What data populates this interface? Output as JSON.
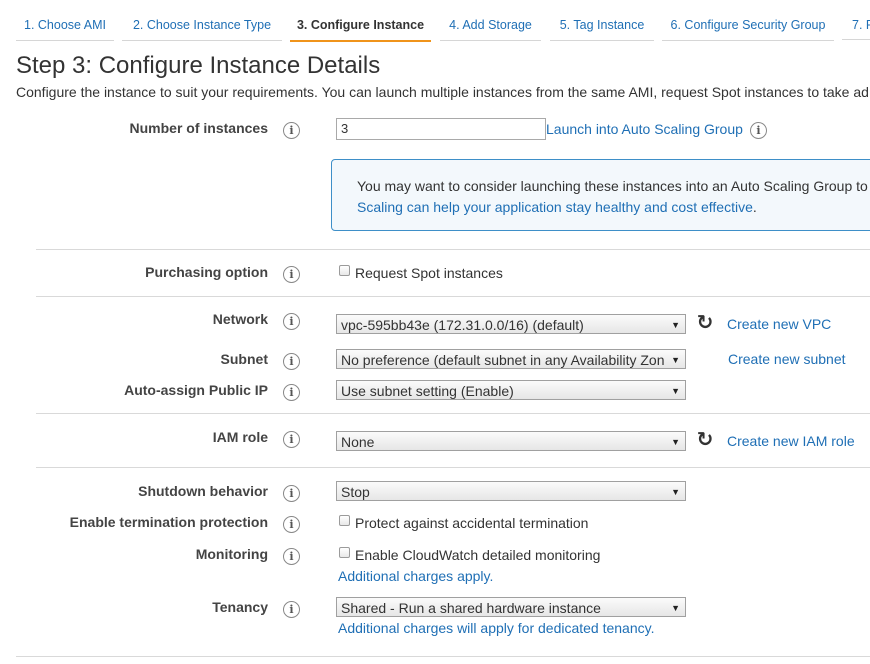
{
  "wizard": {
    "tabs": [
      {
        "label": "1. Choose AMI",
        "active": false
      },
      {
        "label": "2. Choose Instance Type",
        "active": false
      },
      {
        "label": "3. Configure Instance",
        "active": true
      },
      {
        "label": "4. Add Storage",
        "active": false
      },
      {
        "label": "5. Tag Instance",
        "active": false
      },
      {
        "label": "6. Configure Security Group",
        "active": false
      },
      {
        "label": "7. R",
        "active": false
      }
    ]
  },
  "page": {
    "title": "Step 3: Configure Instance Details",
    "description": "Configure the instance to suit your requirements. You can launch multiple instances from the same AMI, request Spot instances to take ad"
  },
  "form": {
    "instances": {
      "label": "Number of instances",
      "value": "3",
      "link": "Launch into Auto Scaling Group"
    },
    "notice": {
      "line1": "You may want to consider launching these instances into an Auto Scaling Group to",
      "line2_link": "Scaling can help your application stay healthy and cost effective",
      "line2_tail": "."
    },
    "purchasing": {
      "label": "Purchasing option",
      "checkbox_label": "Request Spot instances",
      "checked": false
    },
    "network": {
      "label": "Network",
      "value": "vpc-595bb43e (172.31.0.0/16) (default)",
      "link": "Create new VPC"
    },
    "subnet": {
      "label": "Subnet",
      "value": "No preference (default subnet in any Availability Zon",
      "link": "Create new subnet"
    },
    "public_ip": {
      "label": "Auto-assign Public IP",
      "value": "Use subnet setting (Enable)"
    },
    "iam_role": {
      "label": "IAM role",
      "value": "None",
      "link": "Create new IAM role"
    },
    "shutdown": {
      "label": "Shutdown behavior",
      "value": "Stop"
    },
    "termination": {
      "label": "Enable termination protection",
      "checkbox_label": "Protect against accidental termination",
      "checked": false
    },
    "monitoring": {
      "label": "Monitoring",
      "checkbox_label": "Enable CloudWatch detailed monitoring",
      "checked": false,
      "note_link": "Additional charges apply."
    },
    "tenancy": {
      "label": "Tenancy",
      "value": "Shared - Run a shared hardware instance",
      "note_link": "Additional charges will apply for dedicated tenancy."
    }
  },
  "icons": {
    "info": "i",
    "refresh": "↻",
    "dropdown": "▼"
  },
  "colors": {
    "link": "#1f6fb5",
    "active_tab_underline": "#f0941b",
    "notice_border": "#3e8fc8"
  }
}
